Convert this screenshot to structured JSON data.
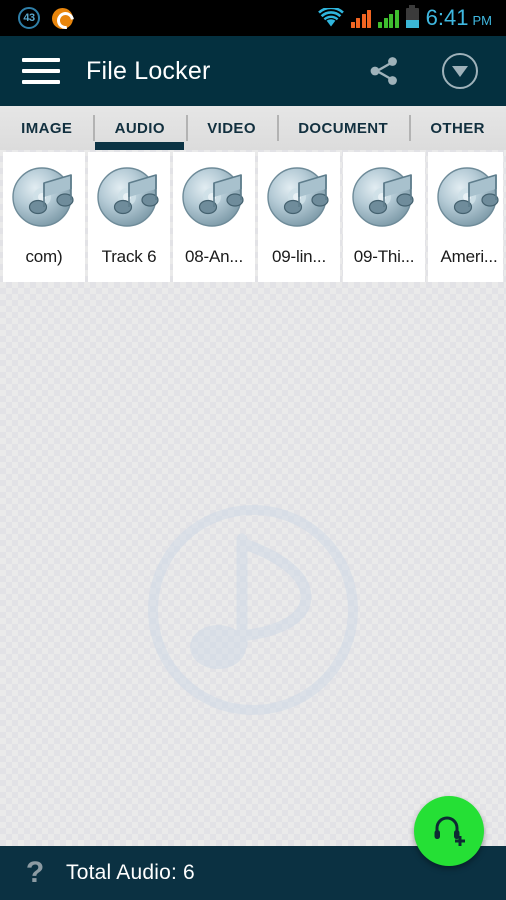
{
  "status_bar": {
    "notification_badge": "43",
    "notification_icon": "orange-circle-icon",
    "sync_icon": "sync-circle-icon",
    "wifi_icon": "wifi-icon",
    "signal_1_icon": "signal-bars-orange-icon",
    "signal_2_icon": "signal-bars-green-icon",
    "battery_icon": "battery-icon",
    "time": "6:41",
    "ampm": "PM",
    "clock_color": "#3fb8e0"
  },
  "app_bar": {
    "menu_icon": "hamburger-menu-icon",
    "title": "File Locker",
    "share_icon": "share-icon",
    "dropdown_icon": "chevron-down-circle-icon",
    "background": "#04303f"
  },
  "tabs": [
    {
      "label": "IMAGE",
      "active": false
    },
    {
      "label": "AUDIO",
      "active": true
    },
    {
      "label": "VIDEO",
      "active": false
    },
    {
      "label": "DOCUMENT",
      "active": false
    },
    {
      "label": "OTHER",
      "active": false
    }
  ],
  "files": [
    {
      "name": "com)",
      "icon": "audio-cd-icon"
    },
    {
      "name": "Track 6",
      "icon": "audio-cd-icon"
    },
    {
      "name": "08-An...",
      "icon": "audio-cd-icon"
    },
    {
      "name": "09-lin...",
      "icon": "audio-cd-icon"
    },
    {
      "name": "09-Thi...",
      "icon": "audio-cd-icon"
    },
    {
      "name": "Ameri...",
      "icon": "audio-cd-icon"
    }
  ],
  "content": {
    "watermark_icon": "music-note-watermark-icon"
  },
  "fab": {
    "icon": "add-audio-headphones-icon",
    "color": "#25e035"
  },
  "bottom_bar": {
    "help_icon": "?",
    "total_label": "Total Audio: 6",
    "background": "#0b3142"
  }
}
